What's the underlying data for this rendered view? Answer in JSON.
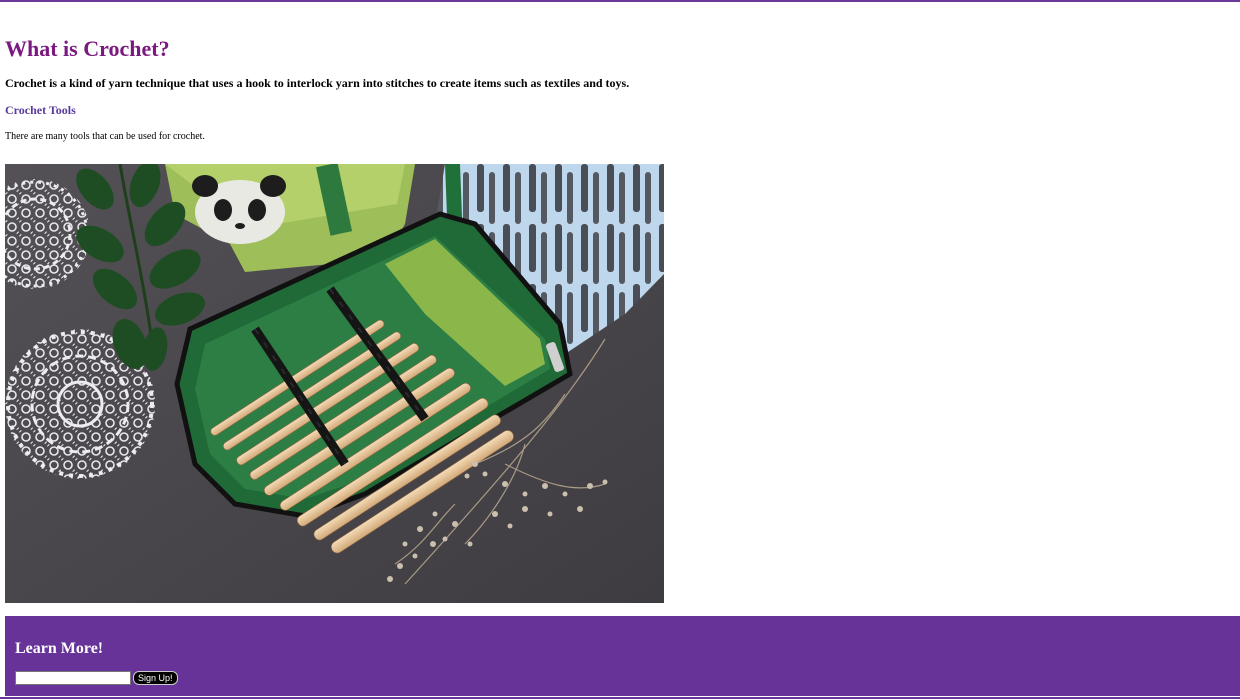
{
  "main": {
    "title": "What is Crochet?",
    "intro": "Crochet is a kind of yarn technique that uses a hook to interlock yarn into stitches to create items such as textiles and toys.",
    "section_link": "Crochet Tools",
    "tools_text": "There are many tools that can be used for crochet.",
    "image_description": "Green crochet hook case with wooden hooks, white lace doilies, leaves and dried flowers on dark fabric"
  },
  "footer": {
    "title": "Learn More!",
    "email_value": "",
    "email_placeholder": "",
    "signup_label": "Sign Up!"
  },
  "colors": {
    "accent": "#673399",
    "title": "#7a1a80",
    "link": "#5a3a9a"
  }
}
